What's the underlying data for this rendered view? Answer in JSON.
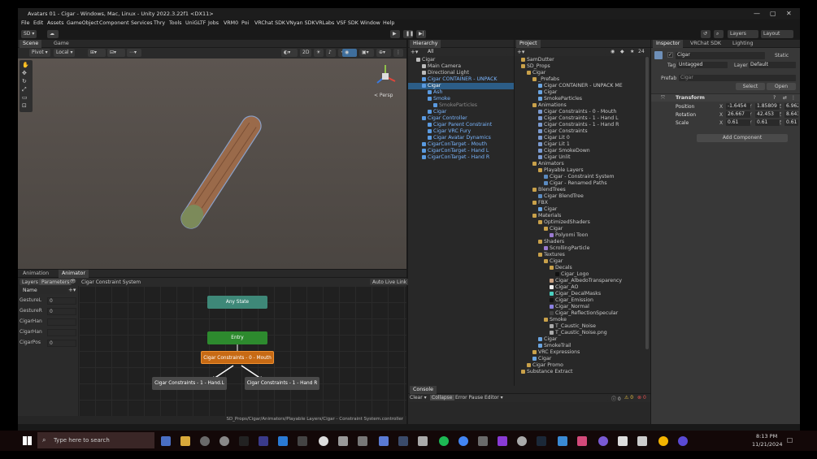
{
  "window": {
    "title": "Avatars 01 - Cigar - Windows, Mac, Linux - Unity 2022.3.22f1 <DX11>",
    "min": "—",
    "max": "▢",
    "close": "✕"
  },
  "menu": [
    "File",
    "Edit",
    "Assets",
    "GameObject",
    "Component",
    "Services",
    "Thry",
    "Tools",
    "UniGLTF",
    "Jobs",
    "VRM0",
    "Poi",
    "VRChat SDK",
    "VNyan SDK",
    "VRLabs",
    "VSF SDK",
    "Window",
    "Help"
  ],
  "toolbar": {
    "account": "SD ▾",
    "layers": "Layers",
    "layout": "Layout"
  },
  "scene": {
    "tabs": [
      "Scene",
      "Game"
    ],
    "pivot": "Pivot ▾",
    "local": "Local ▾",
    "mode2d": "2D",
    "persp": "< Persp"
  },
  "animator": {
    "tabs": [
      "Animation",
      "Animator"
    ],
    "sub": [
      "Layers",
      "Parameters"
    ],
    "title": "Cigar Constraint System",
    "autolive": "Auto Live Link",
    "search": "Name",
    "params": [
      {
        "name": "GestureL",
        "value": "0"
      },
      {
        "name": "GestureR",
        "value": "0"
      },
      {
        "name": "CigarHan",
        "value": ""
      },
      {
        "name": "CigarHan",
        "value": ""
      },
      {
        "name": "CigarPos",
        "value": "0"
      }
    ],
    "nodes": {
      "any": "Any State",
      "entry": "Entry",
      "default": "Cigar Constraints - 0 - Mouth",
      "left": "Cigar Constraints - 1 - Hand.L",
      "right": "Cigar Constraints - 1 - Hand R"
    },
    "path": "SD_Props/Cigar/Animators/Playable Layers/Cigar - Constraint System.controller"
  },
  "hierarchy": {
    "tab": "Hierarchy",
    "search": "All",
    "items": [
      {
        "t": "Cigar",
        "d": 0,
        "c": "w"
      },
      {
        "t": "Main Camera",
        "d": 1,
        "c": "w"
      },
      {
        "t": "Directional Light",
        "d": 1,
        "c": "w"
      },
      {
        "t": "Cigar CONTAINER - UNPACK",
        "d": 1,
        "c": "b"
      },
      {
        "t": "Cigar",
        "d": 1,
        "c": "s"
      },
      {
        "t": "Ash",
        "d": 2,
        "c": "b"
      },
      {
        "t": "Smoke",
        "d": 2,
        "c": "b"
      },
      {
        "t": "SmokeParticles",
        "d": 3,
        "c": "g"
      },
      {
        "t": "Cigar",
        "d": 2,
        "c": "b"
      },
      {
        "t": "Cigar Controller",
        "d": 1,
        "c": "b"
      },
      {
        "t": "Cigar Parent Constraint",
        "d": 2,
        "c": "b"
      },
      {
        "t": "Cigar VRC Fury",
        "d": 2,
        "c": "b"
      },
      {
        "t": "Cigar Avatar Dynamics",
        "d": 2,
        "c": "b"
      },
      {
        "t": "CigarConTarget - Mouth",
        "d": 1,
        "c": "b"
      },
      {
        "t": "CigarConTarget - Hand L",
        "d": 1,
        "c": "b"
      },
      {
        "t": "CigarConTarget - Hand R",
        "d": 1,
        "c": "b"
      }
    ]
  },
  "project": {
    "tab": "Project",
    "count": "24",
    "items": [
      {
        "t": "SamDutter",
        "d": 0,
        "i": "f"
      },
      {
        "t": "SD_Props",
        "d": 0,
        "i": "f"
      },
      {
        "t": "Cigar",
        "d": 1,
        "i": "f"
      },
      {
        "t": "_Prefabs",
        "d": 2,
        "i": "f"
      },
      {
        "t": "Cigar CONTAINER - UNPACK ME",
        "d": 3,
        "i": "p"
      },
      {
        "t": "Cigar",
        "d": 3,
        "i": "p"
      },
      {
        "t": "SmokeParticles",
        "d": 3,
        "i": "p"
      },
      {
        "t": "Animations",
        "d": 2,
        "i": "f"
      },
      {
        "t": "Cigar Constraints - 0 - Mouth",
        "d": 3,
        "i": "a"
      },
      {
        "t": "Cigar Constraints - 1 - Hand L",
        "d": 3,
        "i": "a"
      },
      {
        "t": "Cigar Constraints - 1 - Hand R",
        "d": 3,
        "i": "a"
      },
      {
        "t": "Cigar Constraints",
        "d": 3,
        "i": "a"
      },
      {
        "t": "Cigar Lit 0",
        "d": 3,
        "i": "a"
      },
      {
        "t": "Cigar Lit 1",
        "d": 3,
        "i": "a"
      },
      {
        "t": "Cigar SmokeDown",
        "d": 3,
        "i": "a"
      },
      {
        "t": "Cigar Unlit",
        "d": 3,
        "i": "a"
      },
      {
        "t": "Animators",
        "d": 2,
        "i": "f"
      },
      {
        "t": "Playable Layers",
        "d": 3,
        "i": "f"
      },
      {
        "t": "Cigar - Constraint System",
        "d": 4,
        "i": "c"
      },
      {
        "t": "Cigar - Renamed Paths",
        "d": 4,
        "i": "c"
      },
      {
        "t": "BlendTrees",
        "d": 2,
        "i": "f"
      },
      {
        "t": "Cigar BlendTree",
        "d": 3,
        "i": "c"
      },
      {
        "t": "FBX",
        "d": 2,
        "i": "f"
      },
      {
        "t": "Cigar",
        "d": 3,
        "i": "p"
      },
      {
        "t": "Materials",
        "d": 2,
        "i": "f"
      },
      {
        "t": "OptimizedShaders",
        "d": 3,
        "i": "f"
      },
      {
        "t": "Cigar",
        "d": 4,
        "i": "f"
      },
      {
        "t": "Polyomi Toon",
        "d": 5,
        "i": "s"
      },
      {
        "t": "Shaders",
        "d": 3,
        "i": "f"
      },
      {
        "t": "ScrollingParticle",
        "d": 4,
        "i": "s"
      },
      {
        "t": "Textures",
        "d": 3,
        "i": "f"
      },
      {
        "t": "Cigar",
        "d": 4,
        "i": "f"
      },
      {
        "t": "Decals",
        "d": 5,
        "i": "f"
      },
      {
        "t": "Cigar_Logo",
        "d": 6,
        "i": "k"
      },
      {
        "t": "Cigar_AlbedoTransparency",
        "d": 5,
        "i": "o"
      },
      {
        "t": "Cigar_AO",
        "d": 5,
        "i": "w"
      },
      {
        "t": "Cigar_DecalMasks",
        "d": 5,
        "i": "t"
      },
      {
        "t": "Cigar_Emission",
        "d": 5,
        "i": "k"
      },
      {
        "t": "Cigar_Normal",
        "d": 5,
        "i": "n"
      },
      {
        "t": "Cigar_ReflectionSpecular",
        "d": 5,
        "i": "r"
      },
      {
        "t": "Smoke",
        "d": 4,
        "i": "f"
      },
      {
        "t": "T_Caustic_Noise",
        "d": 5,
        "i": "m"
      },
      {
        "t": "T_Caustic_Noise.png",
        "d": 5,
        "i": "m"
      },
      {
        "t": "Cigar",
        "d": 3,
        "i": "p"
      },
      {
        "t": "SmokeTrail",
        "d": 3,
        "i": "p"
      },
      {
        "t": "VRC Expressions",
        "d": 2,
        "i": "f"
      },
      {
        "t": "Cigar",
        "d": 2,
        "i": "p"
      },
      {
        "t": "Cigar Promo",
        "d": 1,
        "i": "f"
      },
      {
        "t": "Substance Extract",
        "d": 0,
        "i": "f"
      }
    ]
  },
  "inspector": {
    "tabs": [
      "Inspector",
      "VRChat SDK",
      "Lighting"
    ],
    "name": "Cigar",
    "static": "Static",
    "tag_label": "Tag",
    "tag": "Untagged",
    "layer_label": "Layer",
    "layer": "Default",
    "prefab_label": "Prefab",
    "prefab": "Cigar",
    "select": "Select",
    "open": "Open",
    "transform": "Transform",
    "rows": [
      {
        "label": "Position",
        "x": "-1.6454",
        "y": "1.85809",
        "z": "6.96257"
      },
      {
        "label": "Rotation",
        "x": "26.667",
        "y": "42.453",
        "z": "8.643"
      },
      {
        "label": "Scale",
        "x": "0.61",
        "y": "0.61",
        "z": "0.61"
      }
    ],
    "add": "Add Component"
  },
  "console": {
    "tab": "Console",
    "clear": "Clear ▾",
    "collapse": "Collapse",
    "errorpause": "Error Pause",
    "editor": "Editor ▾",
    "c1": "0",
    "c2": "0",
    "c3": "0"
  },
  "taskbar": {
    "search": "Type here to search",
    "time": "8:13 PM",
    "date": "11/21/2024"
  }
}
